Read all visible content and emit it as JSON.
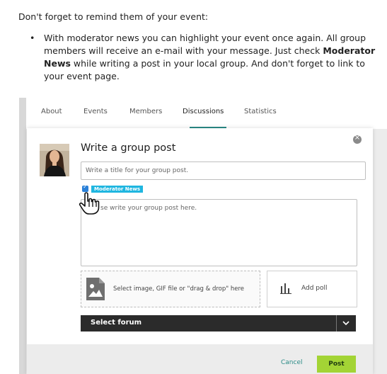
{
  "intro_text": "Don't forget to remind them of your event:",
  "bullet": {
    "prefix": "With moderator news you can highlight your event once again. All group members will receive an e-mail with your message. Just check ",
    "bold": "Moderator News",
    "suffix": " while writing a post in your local group. And don't forget to link to your event page."
  },
  "tabs": [
    "About",
    "Events",
    "Members",
    "Discussions",
    "Statistics"
  ],
  "active_tab": "Discussions",
  "modal": {
    "heading": "Write a group post",
    "title_placeholder": "Write a title for your group post.",
    "moderator_badge": "Moderator News",
    "post_placeholder": "Please write your group post here.",
    "post_placeholder_visible": "se write your group post here.",
    "upload_label": "Select image, GIF file or \"drag & drop\" here",
    "poll_label": "Add poll",
    "forum_label": "Select forum",
    "cancel_label": "Cancel",
    "post_label": "Post"
  },
  "colors": {
    "accent_teal": "#2a8b86",
    "badge_blue": "#1fb6e0",
    "post_green": "#a3d435",
    "forum_dark": "#2b2b2b"
  },
  "icons": [
    "close-icon",
    "checkbox-checked-icon",
    "hand-cursor-icon",
    "image-icon",
    "poll-icon",
    "chevron-down-icon"
  ]
}
